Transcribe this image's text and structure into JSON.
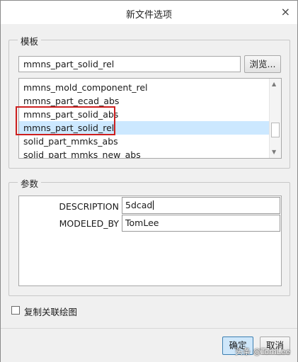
{
  "window": {
    "title": "新文件选项",
    "close_glyph": "×"
  },
  "template": {
    "legend": "模板",
    "input_value": "mmns_part_solid_rel",
    "browse_label": "浏览...",
    "items": [
      "mmns_mold_component_rel",
      "mmns_part_ecad_abs",
      "mmns_part_solid_abs",
      "mmns_part_solid_rel",
      "solid_part_mmks_abs",
      "solid_part_mmks_new_abs"
    ],
    "selected_item": "mmns_part_solid_rel"
  },
  "parameters": {
    "legend": "参数",
    "rows": [
      {
        "name": "DESCRIPTION",
        "value": "5dcad"
      },
      {
        "name": "MODELED_BY",
        "value": "TomLee"
      }
    ]
  },
  "copy_drawing": {
    "label": "复制关联绘图",
    "checked": false
  },
  "buttons": {
    "ok_label": "确定",
    "cancel_label": "取消"
  },
  "watermark": "头条 @TomLee",
  "colors": {
    "selection": "#cce8ff",
    "highlight_box": "#cc1f1f",
    "ok_button_bg": "#cfe7fa",
    "ok_button_border": "#3c7fb1"
  }
}
